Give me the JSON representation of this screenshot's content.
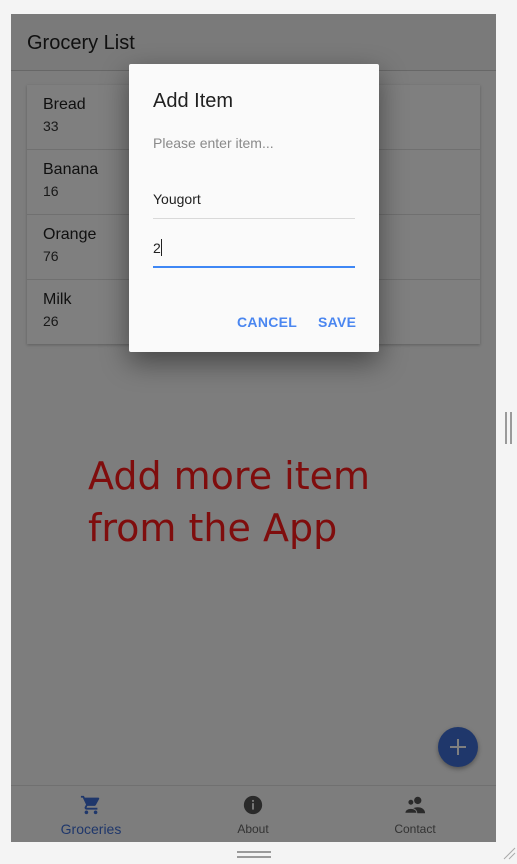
{
  "appbar": {
    "title": "Grocery List"
  },
  "groceries": [
    {
      "name": "Bread",
      "qty": "33"
    },
    {
      "name": "Banana",
      "qty": "16"
    },
    {
      "name": "Orange",
      "qty": "76"
    },
    {
      "name": "Milk",
      "qty": "26"
    }
  ],
  "annotation": {
    "line1": "Add more item",
    "line2": "from the App"
  },
  "fab": {
    "icon": "plus-icon"
  },
  "nav": [
    {
      "label": "Groceries",
      "icon": "cart-icon",
      "active": true
    },
    {
      "label": "About",
      "icon": "info-icon",
      "active": false
    },
    {
      "label": "Contact",
      "icon": "contacts-icon",
      "active": false
    }
  ],
  "dialog": {
    "title": "Add Item",
    "message": "Please enter item...",
    "name_value": "Yougort",
    "qty_value": "2",
    "cancel_label": "CANCEL",
    "save_label": "SAVE"
  },
  "colors": {
    "accent": "#3f6fd6",
    "focus_underline": "#3f87f5",
    "annotation": "#ff1a1a"
  }
}
